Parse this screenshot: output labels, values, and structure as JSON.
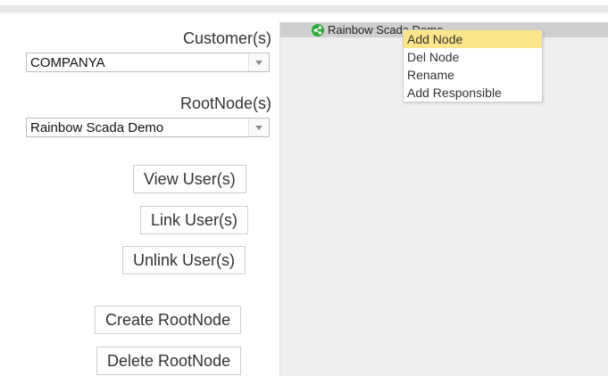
{
  "customers": {
    "label": "Customer(s)",
    "selected": "COMPANYA"
  },
  "rootnodes": {
    "label": "RootNode(s)",
    "selected": "Rainbow Scada Demo"
  },
  "actions": {
    "view_users": "View User(s)",
    "link_users": "Link User(s)",
    "unlink_users": "Unlink User(s)",
    "create_rootnode": "Create RootNode",
    "delete_rootnode": "Delete RootNode"
  },
  "tree": {
    "root_node_label": "Rainbow Scada Demo",
    "root_node_icon": "share-icon",
    "icon_color": "#2eaa3c"
  },
  "context_menu": {
    "items": [
      {
        "label": "Add Node",
        "active": true
      },
      {
        "label": "Del Node",
        "active": false
      },
      {
        "label": "Rename",
        "active": false
      },
      {
        "label": "Add Responsible",
        "active": false
      }
    ],
    "highlight_color": "#fde58a"
  }
}
